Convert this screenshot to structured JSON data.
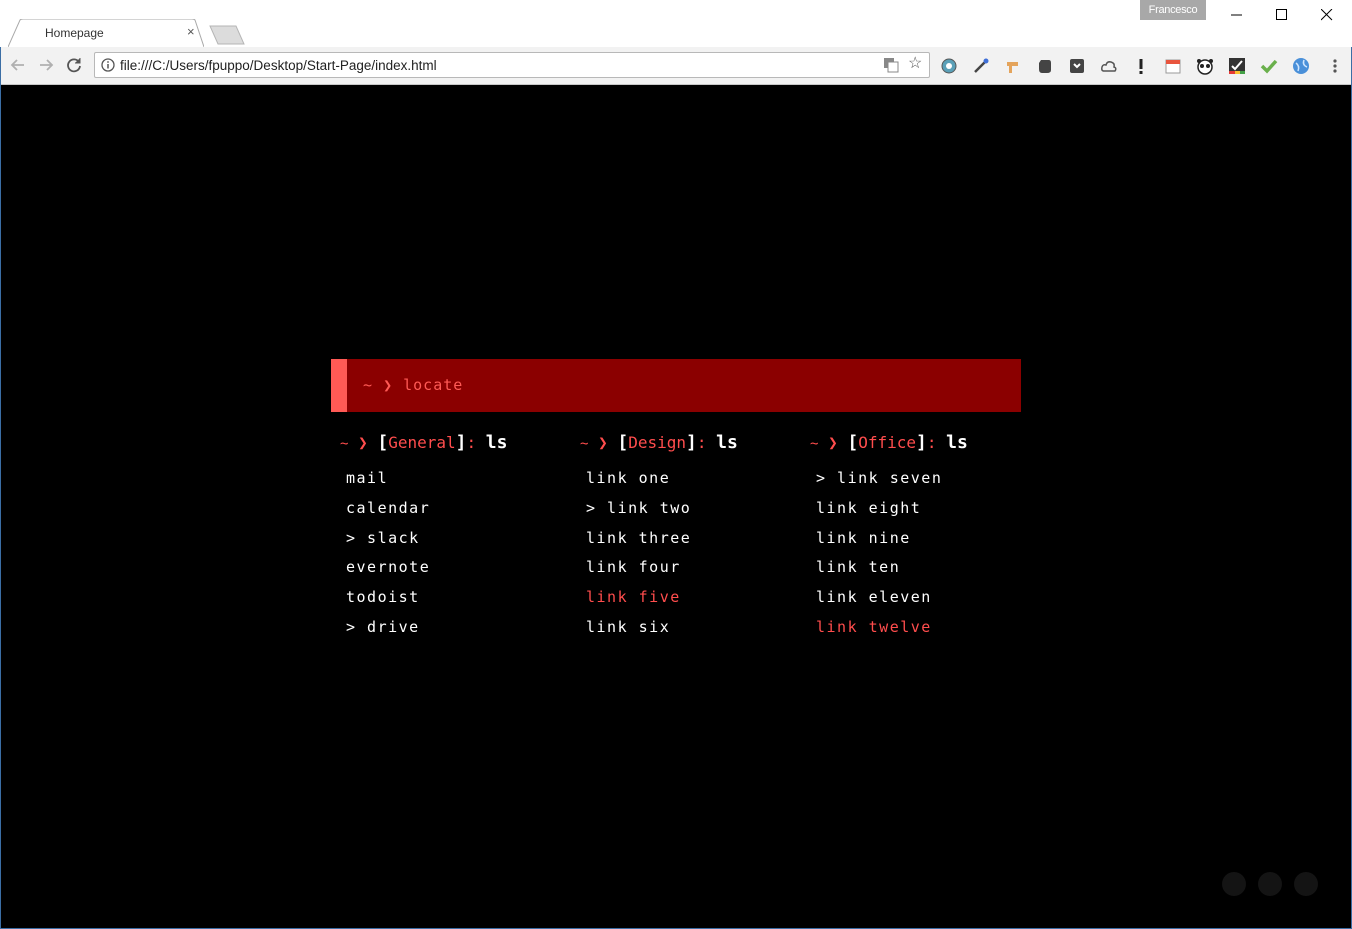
{
  "browser": {
    "tab_title": "Homepage",
    "tab_close": "×",
    "profile_name": "Francesco",
    "url": "file:///C:/Users/fpuppo/Desktop/Start-Page/index.html"
  },
  "colors": {
    "page_bg": "#000000",
    "search_bg": "#8b0000",
    "accent": "#ff5a55",
    "link_active": "#ff4d4d",
    "link": "#ffffff"
  },
  "search": {
    "tilde": "~",
    "arrow": "❯",
    "command": "locate"
  },
  "columns": [
    {
      "tilde": "~",
      "arrow": "❯",
      "open": "[",
      "name": "General",
      "close": "]",
      "colon": ":",
      "cmd": "ls",
      "links": [
        {
          "label": "mail"
        },
        {
          "label": "calendar"
        },
        {
          "label": "> slack"
        },
        {
          "label": "evernote"
        },
        {
          "label": "todoist"
        },
        {
          "label": "> drive"
        }
      ]
    },
    {
      "tilde": "~",
      "arrow": "❯",
      "open": "[",
      "name": "Design",
      "close": "]",
      "colon": ":",
      "cmd": "ls",
      "links": [
        {
          "label": "link one"
        },
        {
          "label": "> link two"
        },
        {
          "label": "link three"
        },
        {
          "label": "link four"
        },
        {
          "label": "link five",
          "active": true
        },
        {
          "label": "link six"
        }
      ]
    },
    {
      "tilde": "~",
      "arrow": "❯",
      "open": "[",
      "name": "Office",
      "close": "]",
      "colon": ":",
      "cmd": "ls",
      "links": [
        {
          "label": "> link seven"
        },
        {
          "label": "link eight"
        },
        {
          "label": "link nine"
        },
        {
          "label": "link ten"
        },
        {
          "label": "link eleven"
        },
        {
          "label": "link twelve",
          "active": true
        }
      ]
    }
  ],
  "extensions": [
    "onion-icon",
    "eyedropper-icon",
    "bookmark-pin-icon",
    "evernote-icon",
    "pocket-icon",
    "cloud-icon",
    "alert-icon",
    "calendar-icon",
    "panda-icon",
    "checklist-icon",
    "checkmark-icon",
    "globe-icon"
  ],
  "page_dots": 3
}
